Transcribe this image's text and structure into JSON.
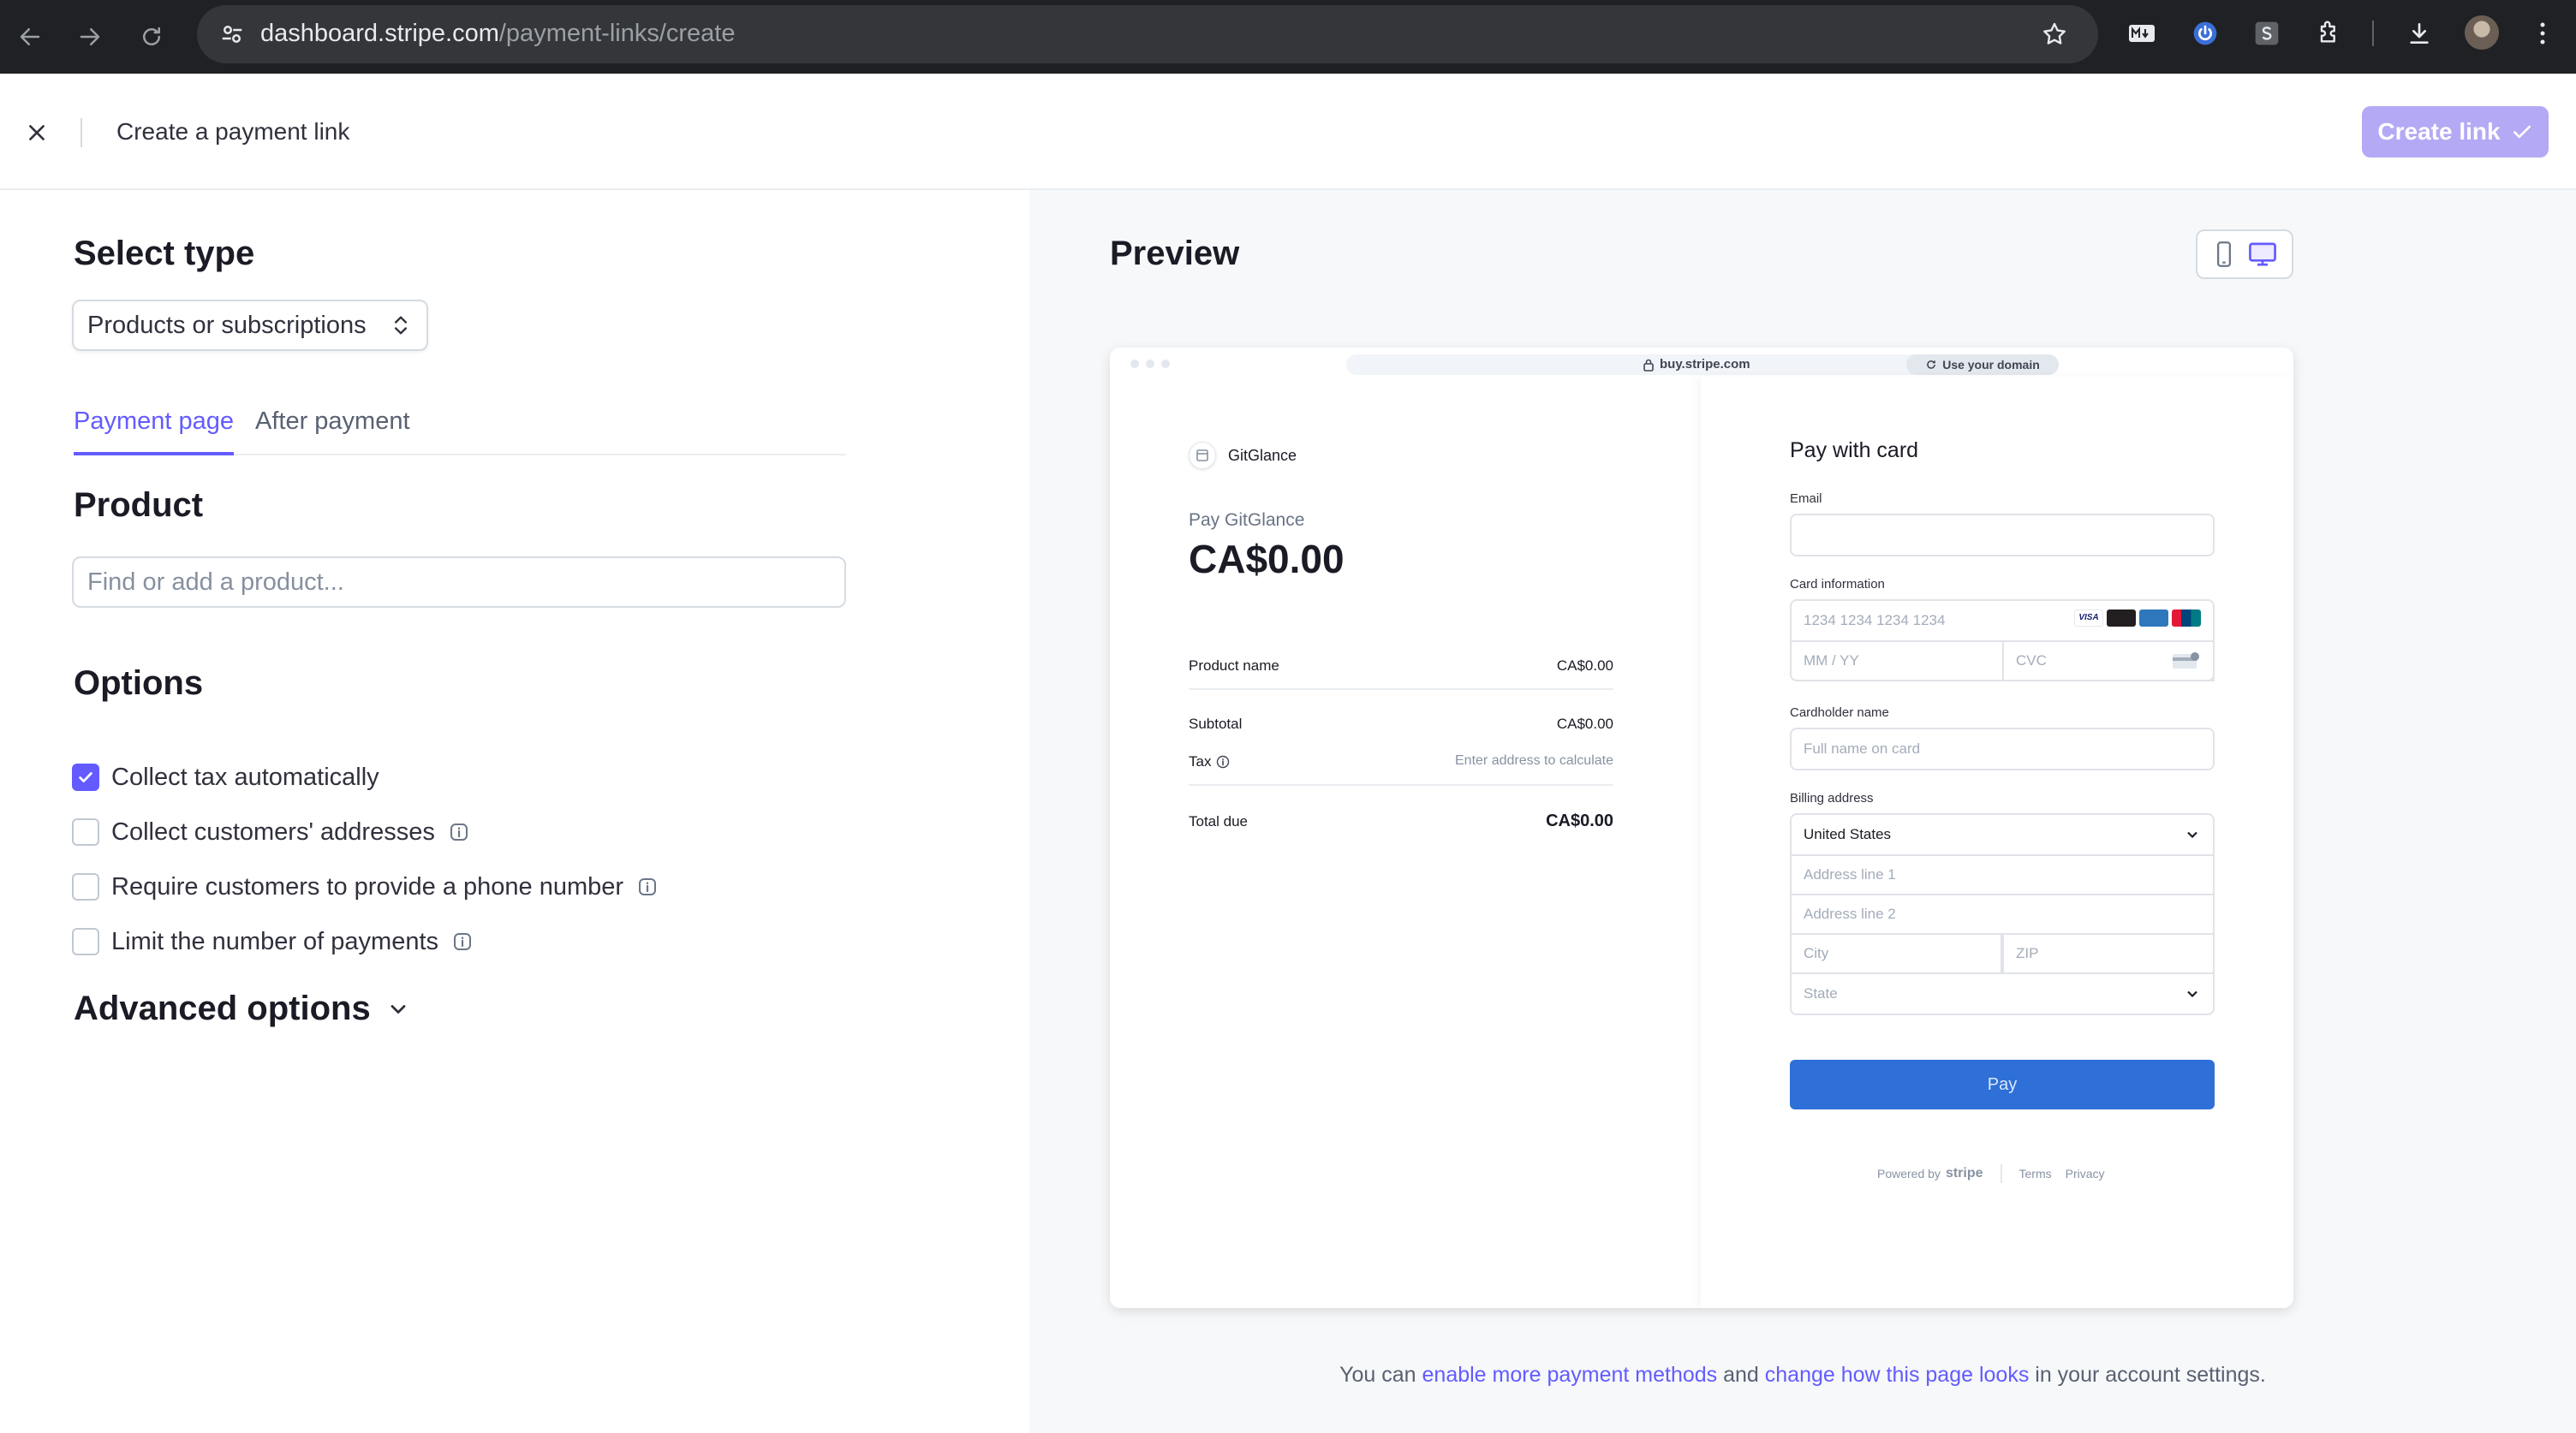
{
  "browser": {
    "url_host": "dashboard.stripe.com",
    "url_path": "/payment-links/create"
  },
  "header": {
    "title": "Create a payment link",
    "create_label": "Create link"
  },
  "left": {
    "select_type_heading": "Select type",
    "type_value": "Products or subscriptions",
    "tabs": [
      {
        "label": "Payment page",
        "active": true
      },
      {
        "label": "After payment",
        "active": false
      }
    ],
    "product_heading": "Product",
    "product_placeholder": "Find or add a product...",
    "options_heading": "Options",
    "options": [
      {
        "label": "Collect tax automatically",
        "checked": true,
        "info": false
      },
      {
        "label": "Collect customers' addresses",
        "checked": false,
        "info": true
      },
      {
        "label": "Require customers to provide a phone number",
        "checked": false,
        "info": true
      },
      {
        "label": "Limit the number of payments",
        "checked": false,
        "info": true
      }
    ],
    "advanced_heading": "Advanced options"
  },
  "preview": {
    "heading": "Preview",
    "mini_url": "buy.stripe.com",
    "use_domain": "Use your domain",
    "merchant": "GitGlance",
    "pay_label": "Pay GitGlance",
    "amount": "CA$0.00",
    "line_items": {
      "product_name": "Product name",
      "product_amount": "CA$0.00",
      "subtotal_label": "Subtotal",
      "subtotal_amount": "CA$0.00",
      "tax_label": "Tax",
      "tax_value": "Enter address to calculate",
      "total_label": "Total due",
      "total_amount": "CA$0.00"
    },
    "form": {
      "heading": "Pay with card",
      "email_label": "Email",
      "card_label": "Card information",
      "card_number_placeholder": "1234 1234 1234 1234",
      "expiry_placeholder": "MM / YY",
      "cvc_placeholder": "CVC",
      "cardholder_label": "Cardholder name",
      "cardholder_placeholder": "Full name on card",
      "billing_label": "Billing address",
      "country": "United States",
      "address1": "Address line 1",
      "address2": "Address line 2",
      "city": "City",
      "zip": "ZIP",
      "state": "State",
      "pay_button": "Pay",
      "card_brand_colors": [
        "#1a1f71",
        "#eb001b",
        "#2e77bc",
        "#0e4c96"
      ]
    },
    "footer": {
      "powered_by": "Powered by",
      "brand": "stripe",
      "terms": "Terms",
      "privacy": "Privacy"
    }
  },
  "bottom_note": {
    "prefix": "You can ",
    "link1": "enable more payment methods",
    "middle": " and ",
    "link2": "change how this page looks",
    "suffix": " in your account settings."
  },
  "colors": {
    "accent": "#635bff",
    "create_button": "#b4a9f5",
    "pay_button": "#2e6fd8"
  }
}
